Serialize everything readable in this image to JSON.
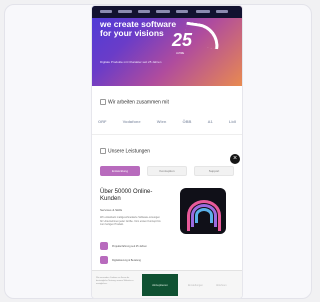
{
  "hero": {
    "title": "we create software for your visions",
    "subtitle": "Digitale Produkte mit Charakter seit 25 Jahren",
    "badge_number": "25",
    "badge_label": "JAHRE"
  },
  "partners": {
    "title": "Wir arbeiten zusammen mit",
    "logos": [
      "ORF",
      "Vodafone",
      "Wien",
      "ÖBB",
      "A1",
      "Lidl"
    ]
  },
  "services": {
    "title": "Unsere Leistungen",
    "tabs": [
      "Entwicklung",
      "Konzeption",
      "Support"
    ],
    "active_tab": "Entwicklung",
    "heading": "Über 50000 Online-Kunden",
    "subheading": "Services & Skills",
    "body": "Wir entwickeln maßgeschneiderte Software-Lösungen für Unternehmen jeder Größe. Vom ersten Konzept bis zum fertigen Produkt.",
    "features": [
      "Projekterfahrung seit 25 Jahren",
      "Digitalisierung & Beratung"
    ]
  },
  "cookie": {
    "text": "Wir verwenden Cookies um Ihnen die bestmögliche Nutzung unserer Website zu ermöglichen.",
    "accept_label": "Akzeptieren",
    "settings_label": "Einstellungen",
    "decline_label": "Ablehnen"
  },
  "icons": {
    "close": "close-icon",
    "feature": "feature-icon",
    "checkbox": "check-icon"
  },
  "colors": {
    "accent": "#b86bbd",
    "cookie_button": "#0f5132",
    "hero_start": "#4b3bd9",
    "hero_end": "#e88a50"
  }
}
